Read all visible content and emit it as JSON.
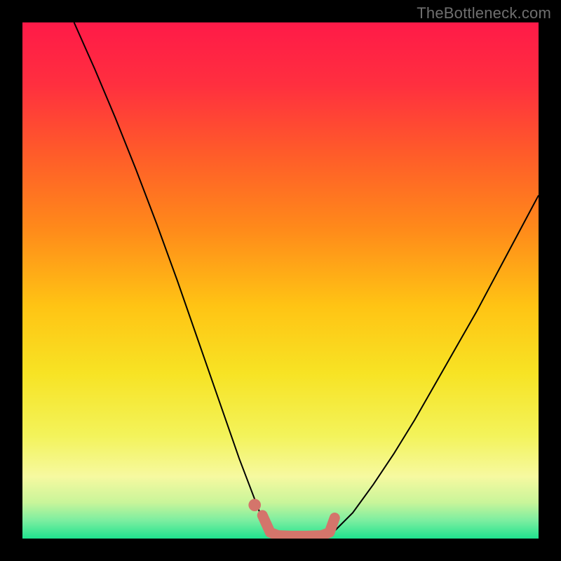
{
  "watermark": "TheBottleneck.com",
  "gradient": {
    "stops": [
      {
        "offset": 0.0,
        "color": "#ff1a48"
      },
      {
        "offset": 0.12,
        "color": "#ff2f3f"
      },
      {
        "offset": 0.25,
        "color": "#ff5a2a"
      },
      {
        "offset": 0.4,
        "color": "#ff8a1a"
      },
      {
        "offset": 0.55,
        "color": "#ffc414"
      },
      {
        "offset": 0.68,
        "color": "#f7e324"
      },
      {
        "offset": 0.8,
        "color": "#f3f35a"
      },
      {
        "offset": 0.88,
        "color": "#f6f9a0"
      },
      {
        "offset": 0.93,
        "color": "#c9f59a"
      },
      {
        "offset": 0.965,
        "color": "#7ceea0"
      },
      {
        "offset": 1.0,
        "color": "#1fe38f"
      }
    ]
  },
  "chart_data": {
    "type": "line",
    "title": "",
    "xlabel": "",
    "ylabel": "",
    "xlim": [
      0,
      100
    ],
    "ylim": [
      0,
      100
    ],
    "series": [
      {
        "name": "left-curve",
        "stroke": "#000000",
        "stroke_width": 2,
        "x": [
          10.0,
          14.0,
          18.0,
          22.0,
          26.0,
          30.0,
          34.0,
          38.0,
          42.0,
          46.0,
          48.0
        ],
        "y": [
          100.0,
          91.0,
          81.5,
          71.5,
          61.0,
          50.0,
          38.5,
          27.0,
          15.5,
          5.0,
          1.0
        ]
      },
      {
        "name": "right-curve",
        "stroke": "#000000",
        "stroke_width": 2,
        "x": [
          60.0,
          64.0,
          68.0,
          72.0,
          76.0,
          80.0,
          84.0,
          88.0,
          92.0,
          96.0,
          100.0
        ],
        "y": [
          1.0,
          5.0,
          10.5,
          16.5,
          23.0,
          30.0,
          37.0,
          44.0,
          51.5,
          59.0,
          66.5
        ]
      },
      {
        "name": "bottom-accent",
        "stroke": "#d4756b",
        "stroke_width": 15,
        "linecap": "round",
        "x": [
          46.5,
          48.0,
          49.5,
          52.0,
          55.0,
          58.0,
          59.5,
          60.5
        ],
        "y": [
          4.5,
          1.2,
          0.6,
          0.5,
          0.5,
          0.6,
          1.2,
          4.0
        ]
      }
    ],
    "markers": [
      {
        "name": "accent-dot",
        "x": 45.0,
        "y": 6.5,
        "r": 1.2,
        "color": "#d4756b"
      }
    ]
  }
}
